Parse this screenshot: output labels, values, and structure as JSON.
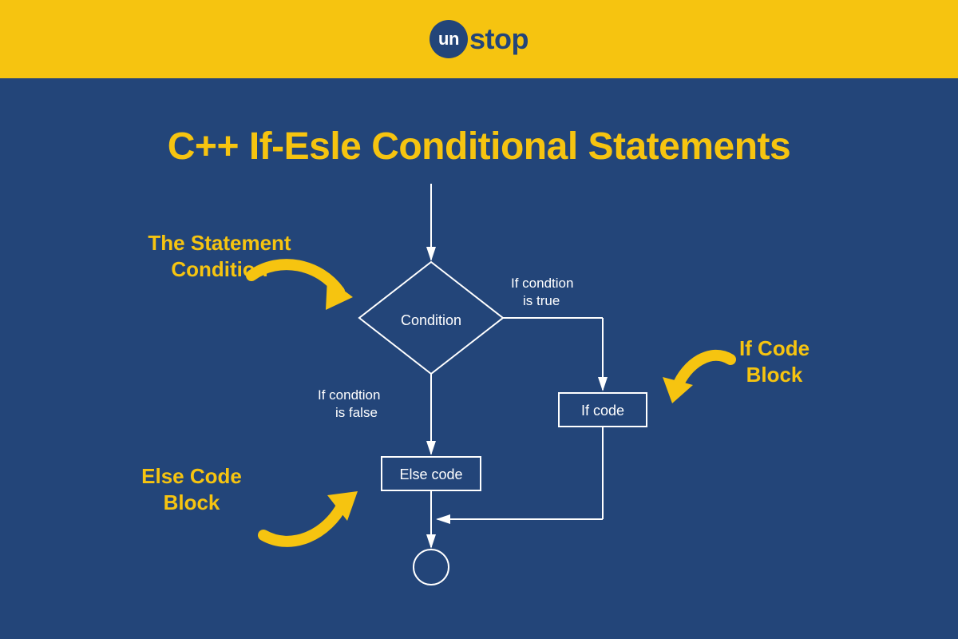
{
  "logo": {
    "circle_text": "un",
    "rest": "stop"
  },
  "title": "C++ If-Esle Conditional Statements",
  "flowchart": {
    "condition": "Condition",
    "true_label_l1": "If condtion",
    "true_label_l2": "is true",
    "false_label_l1": "If condtion",
    "false_label_l2": "is false",
    "if_box": "If code",
    "else_box": "Else code"
  },
  "annotations": {
    "statement_condition_l1": "The Statement",
    "statement_condition_l2": "Condition",
    "if_block_l1": "If Code",
    "if_block_l2": "Block",
    "else_block_l1": "Else Code",
    "else_block_l2": "Block"
  },
  "colors": {
    "accent": "#F6C410",
    "bg": "#234579",
    "white": "#FFFFFF"
  }
}
